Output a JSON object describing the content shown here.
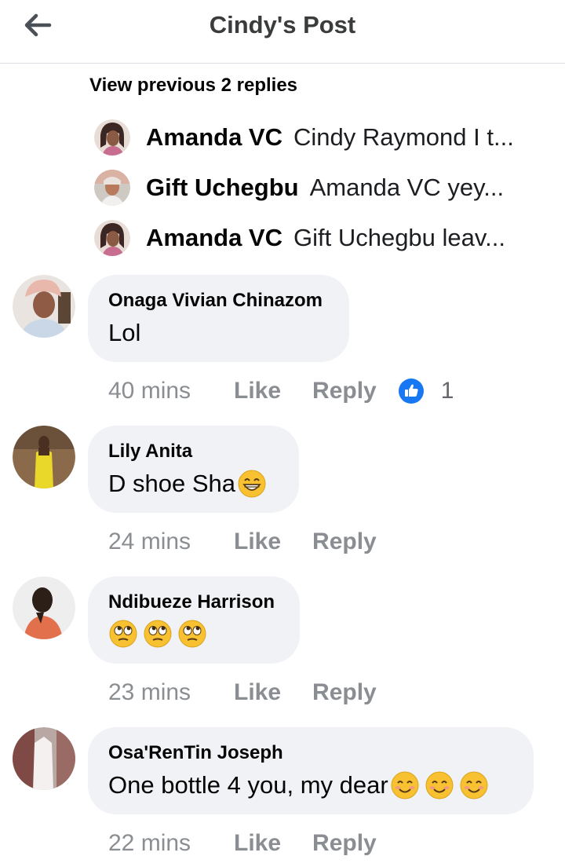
{
  "header": {
    "title": "Cindy's Post",
    "back_icon": "arrow-left-icon"
  },
  "thread": {
    "view_previous": "View previous 2 replies",
    "replies": [
      {
        "name": "Amanda VC",
        "text": "Cindy Raymond I t..."
      },
      {
        "name": "Gift Uchegbu",
        "text": "Amanda VC yey..."
      },
      {
        "name": "Amanda VC",
        "text": "Gift Uchegbu leav..."
      }
    ]
  },
  "comments": [
    {
      "author": "Onaga Vivian Chinazom",
      "text": "Lol",
      "emojis": [],
      "time": "40 mins",
      "like": "Like",
      "reply": "Reply",
      "reaction_count": "1"
    },
    {
      "author": "Lily Anita",
      "text": "D shoe Sha",
      "emojis": [
        "grin"
      ],
      "time": "24 mins",
      "like": "Like",
      "reply": "Reply"
    },
    {
      "author": "Ndibueze Harrison",
      "text": "",
      "emojis": [
        "eye-roll",
        "eye-roll",
        "eye-roll"
      ],
      "time": "23 mins",
      "like": "Like",
      "reply": "Reply"
    },
    {
      "author": "Osa'RenTin Joseph",
      "text": "One bottle 4 you, my dear",
      "emojis": [
        "smile",
        "smile",
        "smile"
      ],
      "time": "22 mins",
      "like": "Like",
      "reply": "Reply"
    }
  ],
  "colors": {
    "like_blue": "#1877f2",
    "bubble": "#f0f2f5",
    "meta_gray": "#8a8d91",
    "emoji_yellow": "#f7c131"
  }
}
